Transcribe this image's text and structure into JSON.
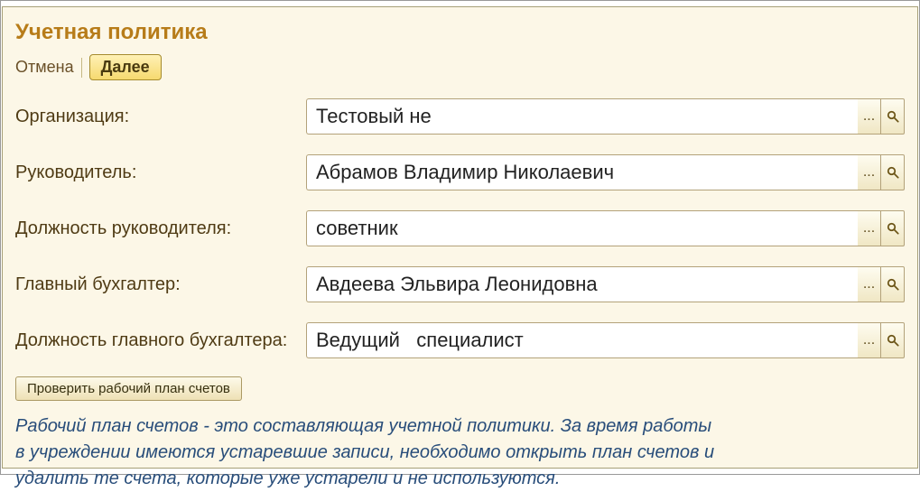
{
  "header": {
    "title": "Учетная политика",
    "cancel_label": "Отмена",
    "next_label": "Далее"
  },
  "fields": {
    "org": {
      "label": "Организация:",
      "value": "Тестовый не"
    },
    "head": {
      "label": "Руководитель:",
      "value": "Абрамов Владимир Николаевич"
    },
    "head_pos": {
      "label": "Должность руководителя:",
      "value": "советник"
    },
    "acct": {
      "label": "Главный бухгалтер:",
      "value": "Авдеева Эльвира Леонидовна"
    },
    "acct_pos": {
      "label": "Должность главного бухгалтера:",
      "value": "Ведущий   специалист"
    }
  },
  "buttons": {
    "check_plan": "Проверить рабочий план счетов"
  },
  "note": "Рабочий план счетов - это составляющая учетной политики. За время работы в учреждении имеются устаревшие записи, необходимо открыть план счетов и удалить те счета, которые уже устарели и не используются."
}
